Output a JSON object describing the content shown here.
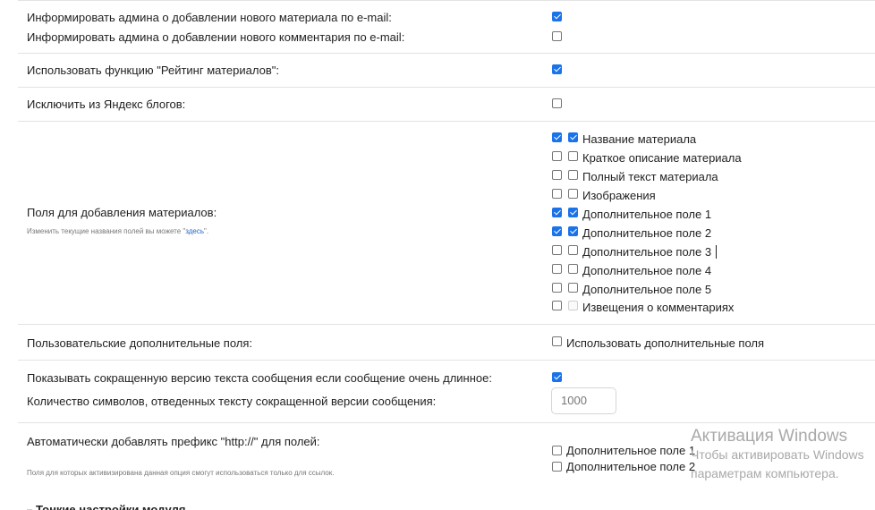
{
  "rows": {
    "notify": {
      "material_label": "Информировать админа о добавлении нового материала по e-mail:",
      "material_checked": true,
      "comment_label": "Информировать админа о добавлении нового комментария по e-mail:",
      "comment_checked": false
    },
    "rating": {
      "label": "Использовать функцию \"Рейтинг материалов\":",
      "checked": true
    },
    "yandex": {
      "label": "Исключить из Яндекс блогов:",
      "checked": false
    },
    "fields": {
      "label": "Поля для добавления материалов:",
      "hint_text": "Изменить текущие названия полей вы можете \"",
      "hint_link": "здесь",
      "hint_end": "\".",
      "items": [
        {
          "label": "Название материала",
          "required": true,
          "enabled": true
        },
        {
          "label": "Краткое описание материала",
          "required": false,
          "enabled": false
        },
        {
          "label": "Полный текст материала",
          "required": false,
          "enabled": false
        },
        {
          "label": "Изображения",
          "required": false,
          "enabled": false
        },
        {
          "label": "Дополнительное поле 1",
          "required": true,
          "enabled": true
        },
        {
          "label": "Дополнительное поле 2",
          "required": true,
          "enabled": true
        },
        {
          "label": "Дополнительное поле 3",
          "required": false,
          "enabled": false
        },
        {
          "label": "Дополнительное поле 4",
          "required": false,
          "enabled": false
        },
        {
          "label": "Дополнительное поле 5",
          "required": false,
          "enabled": false
        },
        {
          "label": "Извещения о комментариях",
          "required": false,
          "enabled": false
        }
      ]
    },
    "custom_fields": {
      "label": "Пользовательские дополнительные поля:",
      "option_label": "Использовать дополнительные поля",
      "checked": false
    },
    "short_version": {
      "label": "Показывать сокращенную версию текста сообщения если сообщение очень длинное:",
      "checked": true,
      "count_label": "Количество символов, отведенных тексту сокращенной версии сообщения:",
      "count_value": "1000"
    },
    "http_prefix": {
      "label": "Автоматически добавлять префикс \"http://\" для полей:",
      "hint": "Поля для которых активизирована данная опция смогут использоваться только для ссылок.",
      "options": [
        {
          "label": "Дополнительное поле 1",
          "checked": false
        },
        {
          "label": "Дополнительное поле 2",
          "checked": false
        }
      ]
    }
  },
  "fieldset_legend": "Тонкие настройки модуля",
  "watermark": {
    "title": "Активация Windows",
    "line1": "Чтобы активировать Windows",
    "line2": "параметрам компьютера."
  }
}
